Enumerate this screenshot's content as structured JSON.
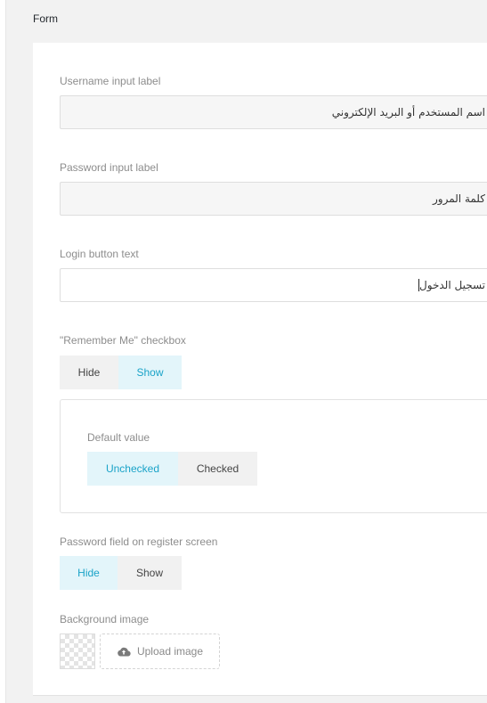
{
  "section": {
    "title": "Form"
  },
  "username": {
    "label": "Username input label",
    "value": "اسم المستخدم أو البريد الإلكتروني"
  },
  "password": {
    "label": "Password input label",
    "value": "كلمة المرور"
  },
  "login": {
    "label": "Login button text",
    "value": "تسجيل الدخول"
  },
  "remember": {
    "label": "\"Remember Me\" checkbox",
    "options": [
      "Hide",
      "Show"
    ],
    "selected": "Show",
    "default": {
      "label": "Default value",
      "options": [
        "Unchecked",
        "Checked"
      ],
      "selected": "Unchecked"
    }
  },
  "register_password": {
    "label": "Password field on register screen",
    "options": [
      "Hide",
      "Show"
    ],
    "selected": "Hide"
  },
  "background": {
    "label": "Background image",
    "upload_label": "Upload image",
    "upload_icon": "cloud-upload-icon"
  },
  "colors": {
    "accent": "#1aa3c8",
    "selected_bg": "#e3f5fa",
    "panel_bg": "#f2f2f2"
  }
}
